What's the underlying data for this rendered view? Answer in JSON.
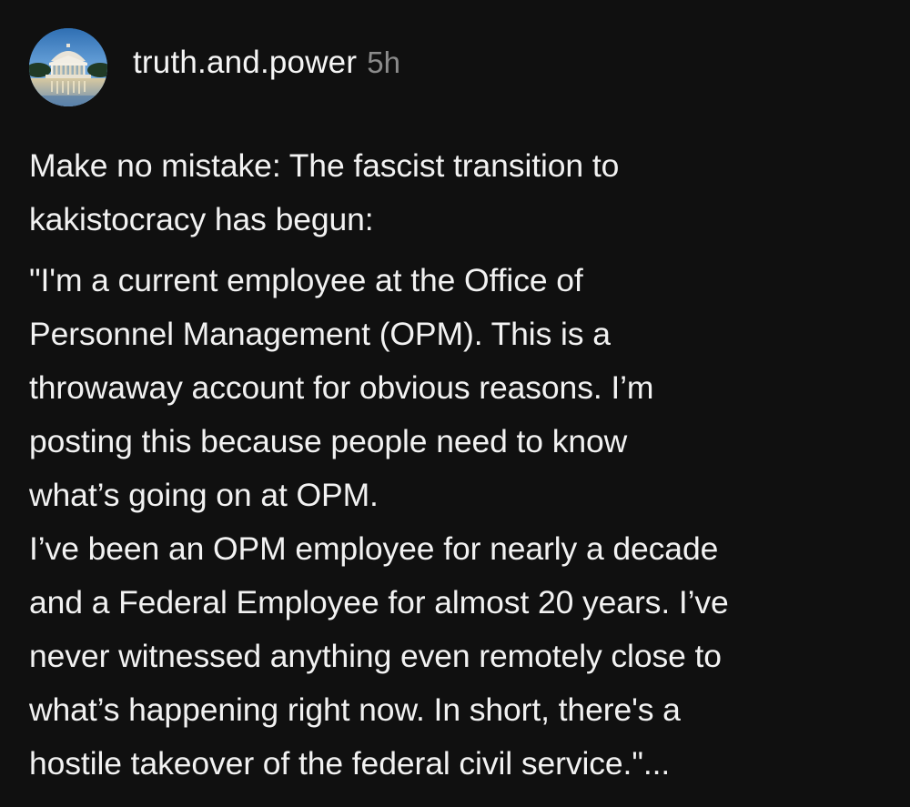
{
  "post": {
    "username": "truth.and.power",
    "timestamp": "5h",
    "paragraphs": [
      {
        "lines": [
          "Make no mistake: The fascist transition to",
          "kakistocracy has begun:"
        ]
      },
      {
        "lines": [
          "\"I'm a current employee at the Office of",
          "Personnel Management (OPM). This is a",
          "throwaway account for obvious reasons. I’m",
          "posting this because people need to know",
          "what’s going on at OPM."
        ]
      },
      {
        "lines": [
          "I’ve been an OPM employee for nearly a decade",
          "and a Federal Employee for almost 20 years. I’ve",
          "never witnessed anything even remotely close to",
          "what’s happening right now. In short, there's a",
          "hostile takeover of the federal civil service.\"..."
        ]
      }
    ]
  },
  "colors": {
    "background": "#101010",
    "text": "#f2f2f2",
    "timestamp": "#8b8b8b"
  }
}
